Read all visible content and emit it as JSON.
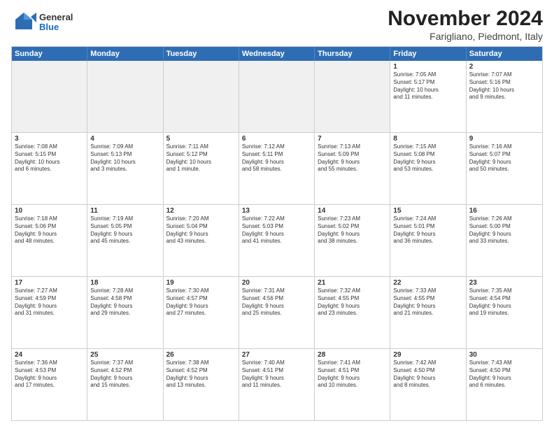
{
  "logo": {
    "general": "General",
    "blue": "Blue"
  },
  "title": "November 2024",
  "subtitle": "Farigliano, Piedmont, Italy",
  "weekdays": [
    "Sunday",
    "Monday",
    "Tuesday",
    "Wednesday",
    "Thursday",
    "Friday",
    "Saturday"
  ],
  "rows": [
    [
      {
        "day": "",
        "info": ""
      },
      {
        "day": "",
        "info": ""
      },
      {
        "day": "",
        "info": ""
      },
      {
        "day": "",
        "info": ""
      },
      {
        "day": "",
        "info": ""
      },
      {
        "day": "1",
        "info": "Sunrise: 7:05 AM\nSunset: 5:17 PM\nDaylight: 10 hours\nand 11 minutes."
      },
      {
        "day": "2",
        "info": "Sunrise: 7:07 AM\nSunset: 5:16 PM\nDaylight: 10 hours\nand 9 minutes."
      }
    ],
    [
      {
        "day": "3",
        "info": "Sunrise: 7:08 AM\nSunset: 5:15 PM\nDaylight: 10 hours\nand 6 minutes."
      },
      {
        "day": "4",
        "info": "Sunrise: 7:09 AM\nSunset: 5:13 PM\nDaylight: 10 hours\nand 3 minutes."
      },
      {
        "day": "5",
        "info": "Sunrise: 7:11 AM\nSunset: 5:12 PM\nDaylight: 10 hours\nand 1 minute."
      },
      {
        "day": "6",
        "info": "Sunrise: 7:12 AM\nSunset: 5:11 PM\nDaylight: 9 hours\nand 58 minutes."
      },
      {
        "day": "7",
        "info": "Sunrise: 7:13 AM\nSunset: 5:09 PM\nDaylight: 9 hours\nand 55 minutes."
      },
      {
        "day": "8",
        "info": "Sunrise: 7:15 AM\nSunset: 5:08 PM\nDaylight: 9 hours\nand 53 minutes."
      },
      {
        "day": "9",
        "info": "Sunrise: 7:16 AM\nSunset: 5:07 PM\nDaylight: 9 hours\nand 50 minutes."
      }
    ],
    [
      {
        "day": "10",
        "info": "Sunrise: 7:18 AM\nSunset: 5:06 PM\nDaylight: 9 hours\nand 48 minutes."
      },
      {
        "day": "11",
        "info": "Sunrise: 7:19 AM\nSunset: 5:05 PM\nDaylight: 9 hours\nand 45 minutes."
      },
      {
        "day": "12",
        "info": "Sunrise: 7:20 AM\nSunset: 5:04 PM\nDaylight: 9 hours\nand 43 minutes."
      },
      {
        "day": "13",
        "info": "Sunrise: 7:22 AM\nSunset: 5:03 PM\nDaylight: 9 hours\nand 41 minutes."
      },
      {
        "day": "14",
        "info": "Sunrise: 7:23 AM\nSunset: 5:02 PM\nDaylight: 9 hours\nand 38 minutes."
      },
      {
        "day": "15",
        "info": "Sunrise: 7:24 AM\nSunset: 5:01 PM\nDaylight: 9 hours\nand 36 minutes."
      },
      {
        "day": "16",
        "info": "Sunrise: 7:26 AM\nSunset: 5:00 PM\nDaylight: 9 hours\nand 33 minutes."
      }
    ],
    [
      {
        "day": "17",
        "info": "Sunrise: 7:27 AM\nSunset: 4:59 PM\nDaylight: 9 hours\nand 31 minutes."
      },
      {
        "day": "18",
        "info": "Sunrise: 7:28 AM\nSunset: 4:58 PM\nDaylight: 9 hours\nand 29 minutes."
      },
      {
        "day": "19",
        "info": "Sunrise: 7:30 AM\nSunset: 4:57 PM\nDaylight: 9 hours\nand 27 minutes."
      },
      {
        "day": "20",
        "info": "Sunrise: 7:31 AM\nSunset: 4:56 PM\nDaylight: 9 hours\nand 25 minutes."
      },
      {
        "day": "21",
        "info": "Sunrise: 7:32 AM\nSunset: 4:55 PM\nDaylight: 9 hours\nand 23 minutes."
      },
      {
        "day": "22",
        "info": "Sunrise: 7:33 AM\nSunset: 4:55 PM\nDaylight: 9 hours\nand 21 minutes."
      },
      {
        "day": "23",
        "info": "Sunrise: 7:35 AM\nSunset: 4:54 PM\nDaylight: 9 hours\nand 19 minutes."
      }
    ],
    [
      {
        "day": "24",
        "info": "Sunrise: 7:36 AM\nSunset: 4:53 PM\nDaylight: 9 hours\nand 17 minutes."
      },
      {
        "day": "25",
        "info": "Sunrise: 7:37 AM\nSunset: 4:52 PM\nDaylight: 9 hours\nand 15 minutes."
      },
      {
        "day": "26",
        "info": "Sunrise: 7:38 AM\nSunset: 4:52 PM\nDaylight: 9 hours\nand 13 minutes."
      },
      {
        "day": "27",
        "info": "Sunrise: 7:40 AM\nSunset: 4:51 PM\nDaylight: 9 hours\nand 11 minutes."
      },
      {
        "day": "28",
        "info": "Sunrise: 7:41 AM\nSunset: 4:51 PM\nDaylight: 9 hours\nand 10 minutes."
      },
      {
        "day": "29",
        "info": "Sunrise: 7:42 AM\nSunset: 4:50 PM\nDaylight: 9 hours\nand 8 minutes."
      },
      {
        "day": "30",
        "info": "Sunrise: 7:43 AM\nSunset: 4:50 PM\nDaylight: 9 hours\nand 6 minutes."
      }
    ]
  ]
}
